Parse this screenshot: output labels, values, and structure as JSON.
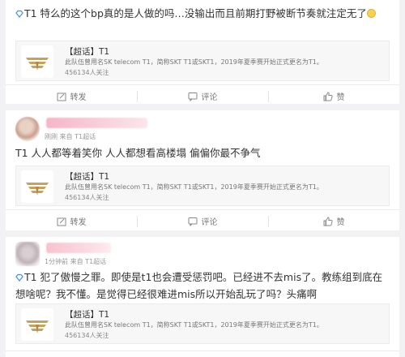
{
  "posts": [
    {
      "text": "T1 特么的这个bp真的是人做的吗…没输出而且前期打野被断节奏就注定无了",
      "topic": {
        "title": "【超话】T1",
        "desc": "此队伍曾用名SK telecom T1，简称SKT T1或SKT1，2019年夏季赛开始正式更名为T1。",
        "fans": "456134人关注"
      },
      "actions": {
        "repost": "转发",
        "comment": "评论",
        "like": "赞"
      }
    },
    {
      "meta_time": "刚刚",
      "meta_source": "来自 T1超话",
      "text": "T1 人人都等着笑你 人人都想看高楼塌 偏偏你最不争气",
      "topic": {
        "title": "【超话】T1",
        "desc": "此队伍曾用名SK telecom T1，简称SKT T1或SKT1，2019年夏季赛开始正式更名为T1。",
        "fans": "456134人关注"
      },
      "actions": {
        "repost": "转发",
        "comment": "评论",
        "like": "赞"
      }
    },
    {
      "meta_time": "1分钟前",
      "meta_source": "来自 T1超话",
      "text": "T1 犯了傲慢之罪。即使是t1也会遭受惩罚吧。已经进不去mis了。教练组到底在想啥呢？我不懂。是觉得已经很难进mis所以开始乱玩了吗？头痛啊",
      "topic": {
        "title": "【超话】T1",
        "desc": "此队伍曾用名SK telecom T1，简称SKT T1或SKT1，2019年夏季赛开始正式更名为T1。",
        "fans": "456134人关注"
      }
    }
  ],
  "colors": {
    "background": "#f2f2f5",
    "card": "#ffffff",
    "topic_bg": "#f7f7f7",
    "diamond": "#4a90e2",
    "logo_gold": "#c9a25a"
  }
}
